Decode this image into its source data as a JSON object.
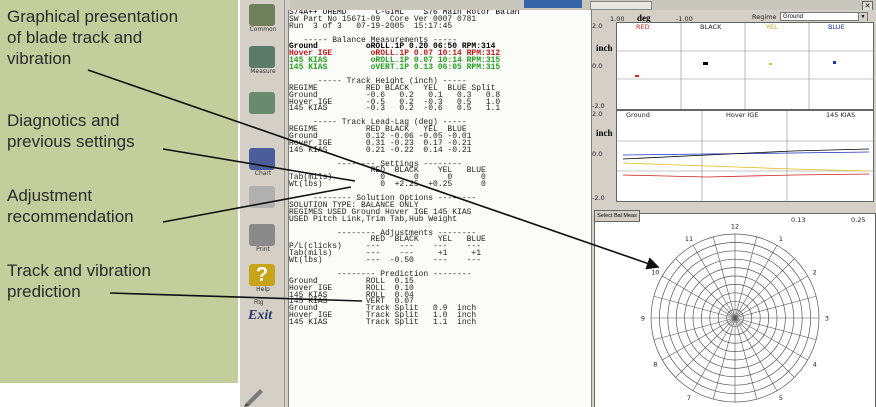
{
  "annotations": [
    {
      "name": "annotation-graphical-presentation",
      "text": "Graphical presentation\nof blade track and\nvibration"
    },
    {
      "name": "annotation-diagnostics",
      "text": "Diagnotics and\nprevious settings"
    },
    {
      "name": "annotation-adjustment",
      "text": "Adjustment\nrecommendation"
    },
    {
      "name": "annotation-prediction",
      "text": "Track and vibration\nprediction"
    }
  ],
  "toolbar": {
    "buttons": [
      {
        "name": "toolbar-button-1",
        "label": "Common",
        "color": "#6e7f5a"
      },
      {
        "name": "toolbar-button-2",
        "label": "Measure",
        "color": "#5c7a6a"
      },
      {
        "name": "toolbar-button-3",
        "label": "",
        "color": "#6a8a70"
      },
      {
        "name": "toolbar-button-4",
        "label": "Chart",
        "color": "#4c5e9a"
      },
      {
        "name": "toolbar-button-5",
        "label": "",
        "color": "#b0b0b0"
      },
      {
        "name": "toolbar-button-6",
        "label": "Print",
        "color": "#8a8a8a"
      },
      {
        "name": "toolbar-button-7",
        "label": "Help",
        "color": "#c8a41a"
      },
      {
        "name": "toolbar-button-8",
        "label": "Exit",
        "color": "#3c4c7c"
      }
    ],
    "exit_small": "Rtg",
    "exit_big": "Exit"
  },
  "report": {
    "lines": [
      {
        "t": "S74A++ OHEMD      C-GIML    S76 Main Rotor Balan",
        "c": "head"
      },
      {
        "t": "SW Part No 15671-09  Core Ver 0007 0781",
        "c": ""
      },
      {
        "t": "Run  3 of 3   07-19-2005  15:17:45",
        "c": ""
      },
      {
        "t": "",
        "c": ""
      },
      {
        "t": "   ----- Balance Measurements -----",
        "c": ""
      },
      {
        "t": "Ground          oROLL.1P 0.20 06:50 RPM:314",
        "c": "bold"
      },
      {
        "t": "Hover IGE        oROLL.1P 0.07 10:14 RPM:312",
        "c": "red"
      },
      {
        "t": "145 KIAS         oROLL.1P 0.07 10:14 RPM:315",
        "c": "green"
      },
      {
        "t": "145 KIAS         oVERT.1P 0.13 06:05 RPM:315",
        "c": "green"
      },
      {
        "t": "",
        "c": ""
      },
      {
        "t": "      ----- Track Height (inch) -----",
        "c": ""
      },
      {
        "t": "REGIME          RED BLACK   YEL  BLUE Split",
        "c": ""
      },
      {
        "t": "Ground          -0.6   0.2   0.1   0.3   0.8",
        "c": ""
      },
      {
        "t": "Hover IGE       -0.5   0.2  -0.3   0.5   1.0",
        "c": ""
      },
      {
        "t": "145 KIAS        -0.3   0.2  -0.6   0.5   1.1",
        "c": ""
      },
      {
        "t": "",
        "c": ""
      },
      {
        "t": "     ----- Track Lead-Lag (deg) -----",
        "c": ""
      },
      {
        "t": "REGIME          RED BLACK   YEL  BLUE",
        "c": ""
      },
      {
        "t": "Ground          0.12 -0.06 -0.05 -0.01",
        "c": ""
      },
      {
        "t": "Hover IGE       0.31 -0.23  0.17 -0.21",
        "c": ""
      },
      {
        "t": "145 KIAS        0.21 -0.22  0.14 -0.21",
        "c": ""
      },
      {
        "t": "",
        "c": ""
      },
      {
        "t": "          -------- Settings --------",
        "c": ""
      },
      {
        "t": "                 RED  BLACK    YEL   BLUE",
        "c": ""
      },
      {
        "t": "Tab(mils)          0      0      0      0",
        "c": ""
      },
      {
        "t": "Wt(lbs)            0  +2.25  +0.25      0",
        "c": ""
      },
      {
        "t": "",
        "c": ""
      },
      {
        "t": "     -------- Solution Options --------",
        "c": ""
      },
      {
        "t": "SOLUTION TYPE: BALANCE ONLY",
        "c": ""
      },
      {
        "t": "REGIMES USED Ground Hover IGE 145 KIAS",
        "c": ""
      },
      {
        "t": "USED Pitch Link,Trim Tab,Hub Weight",
        "c": ""
      },
      {
        "t": "",
        "c": ""
      },
      {
        "t": "          -------- Adjustments --------",
        "c": ""
      },
      {
        "t": "                 RED  BLACK    YEL   BLUE",
        "c": ""
      },
      {
        "t": "P/L(clicks)     ---    ---    ---    ---",
        "c": ""
      },
      {
        "t": "Tab(mils)       ---    ---     +1     +1",
        "c": ""
      },
      {
        "t": "Wt(lbs)         ---  -0.50    ---    ---",
        "c": ""
      },
      {
        "t": "",
        "c": ""
      },
      {
        "t": "          -------- Prediction --------",
        "c": ""
      },
      {
        "t": "Ground          ROLL  0.15",
        "c": ""
      },
      {
        "t": "Hover IGE       ROLL  0.10",
        "c": ""
      },
      {
        "t": "145 KIAS        ROLL  0.04",
        "c": ""
      },
      {
        "t": "145 KIAS        VERT  0.07",
        "c": ""
      },
      {
        "t": "Ground          Track Split   0.9  inch",
        "c": ""
      },
      {
        "t": "Hover IGE       Track Split   1.0  inch",
        "c": ""
      },
      {
        "t": "145 KIAS        Track Split   1.1  inch",
        "c": ""
      }
    ]
  },
  "graphs": {
    "top_left_num": "1.00",
    "deg_label": "deg",
    "top_mid_num": "-1.00",
    "regime_label": "Regime",
    "regime_value": "Ground",
    "inch_label": "inch",
    "y_top": "2.0",
    "y_mid": "0.0",
    "y_bot": "-2.0",
    "blade_headers": [
      "RED",
      "BLACK",
      "YEL",
      "BLUE"
    ],
    "regime_headers": [
      "Ground",
      "Hover IGE",
      "145 KIAS"
    ],
    "select_button": "Select Bal Meas",
    "polar_scale_labels": [
      "0.13",
      "0.25"
    ],
    "polar_clock": [
      "12",
      "1",
      "2",
      "3",
      "4",
      "5",
      "6",
      "7",
      "8",
      "9",
      "10",
      "11"
    ],
    "colors": {
      "red": "#d02020",
      "black": "#000000",
      "yellow": "#e0c020",
      "blue": "#1830c0",
      "grid": "#8a8a8a"
    }
  }
}
